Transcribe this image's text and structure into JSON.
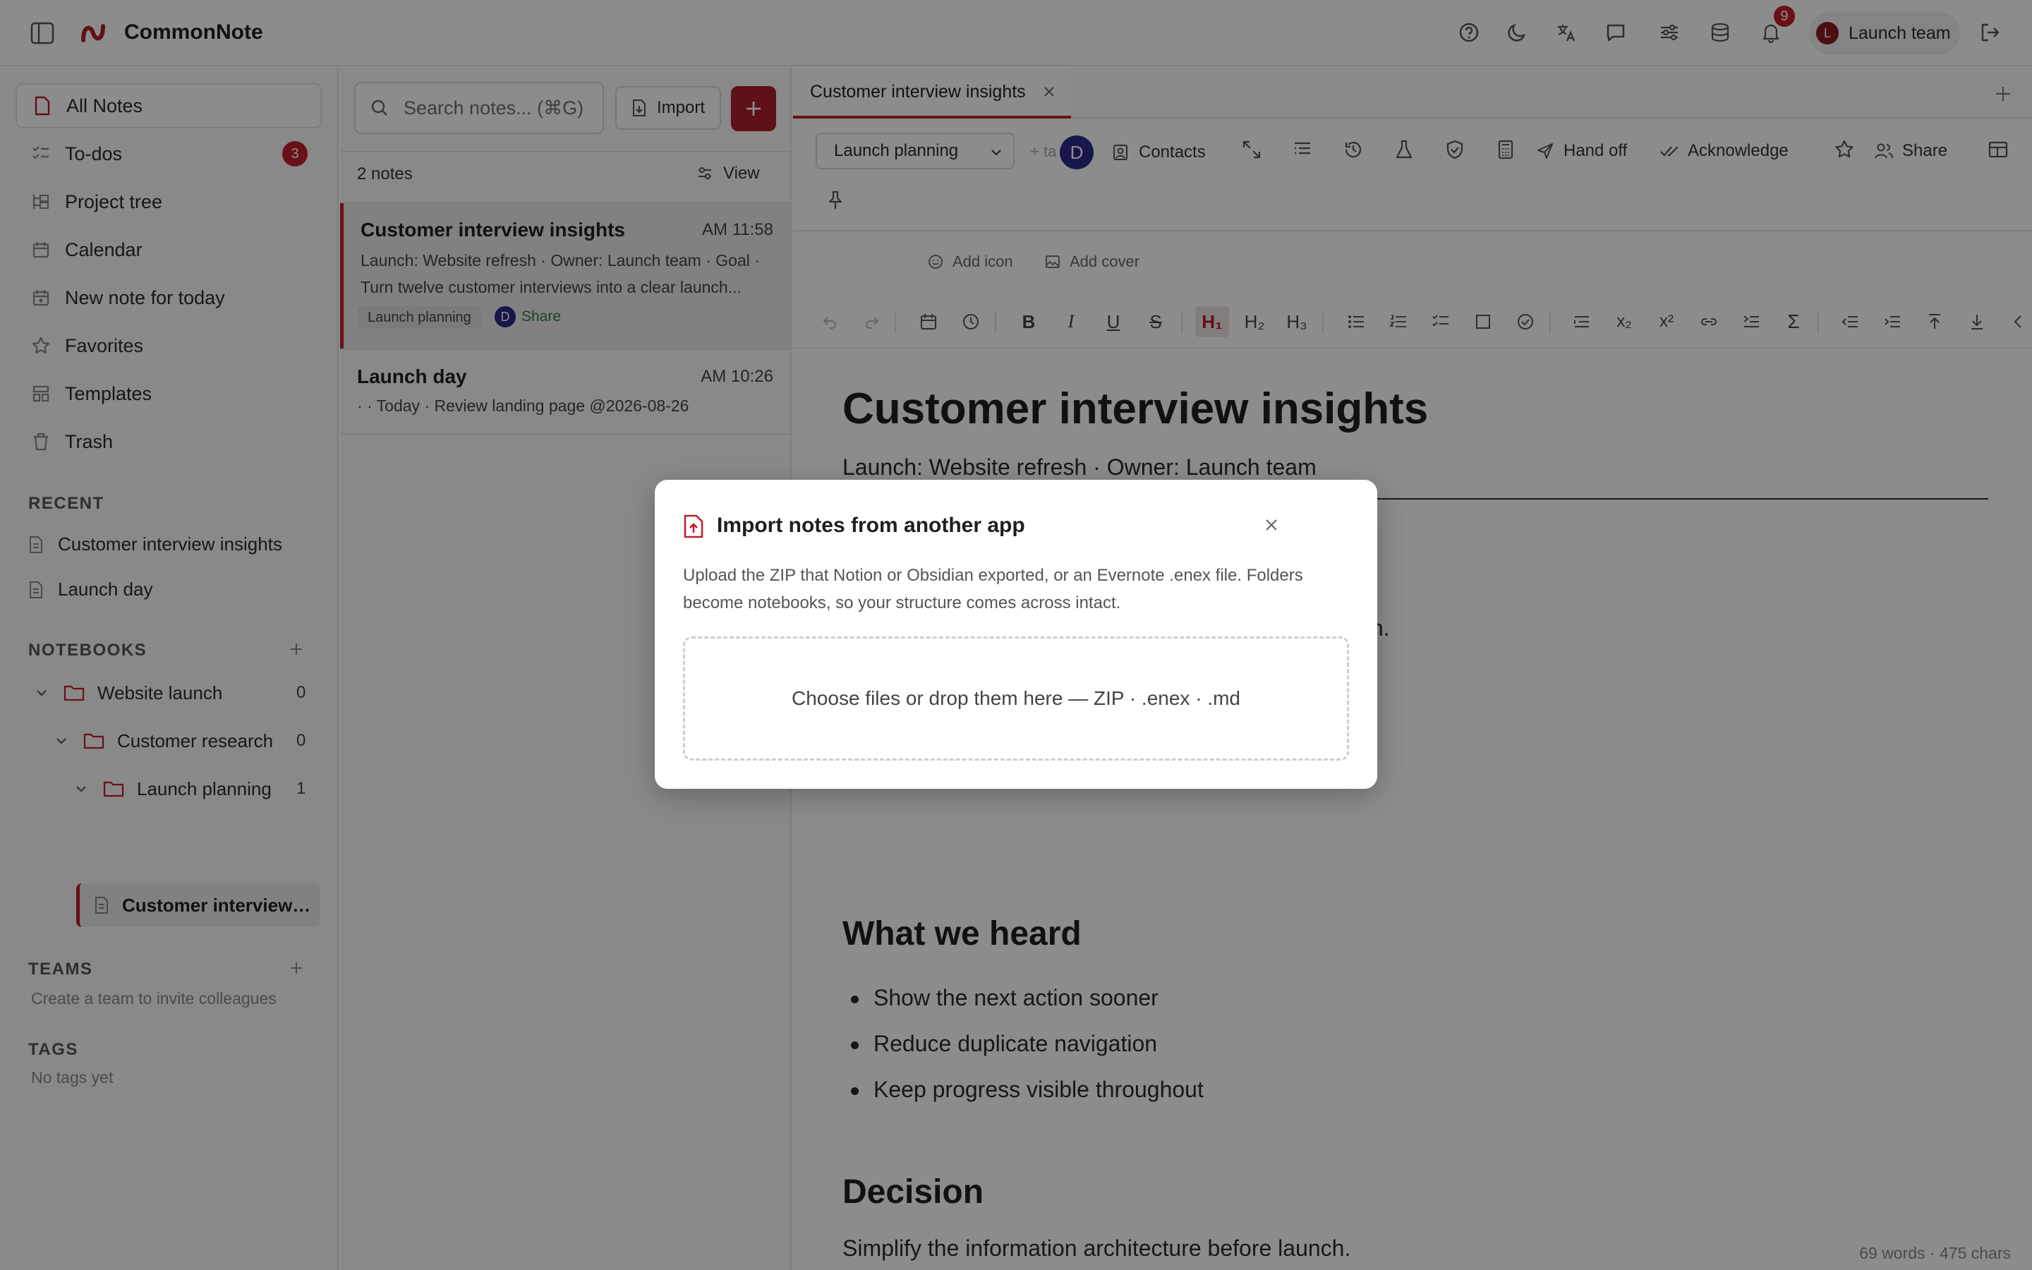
{
  "app": {
    "name": "CommonNote"
  },
  "topbar": {
    "notification_count": "9",
    "team": {
      "initial": "L",
      "label": "Launch team"
    },
    "icons": [
      "help-icon",
      "moon-icon",
      "translate-icon",
      "chat-icon",
      "sliders-icon",
      "database-icon",
      "bell-icon",
      "logout-icon"
    ]
  },
  "sidebar": {
    "nav": [
      {
        "label": "All Notes",
        "icon": "note-icon"
      },
      {
        "label": "To-dos",
        "icon": "checklist-icon",
        "badge": "3"
      },
      {
        "label": "Project tree",
        "icon": "tree-icon"
      },
      {
        "label": "Calendar",
        "icon": "calendar-icon"
      },
      {
        "label": "New note for today",
        "icon": "calendar-plus-icon"
      },
      {
        "label": "Favorites",
        "icon": "star-icon"
      },
      {
        "label": "Templates",
        "icon": "template-icon"
      },
      {
        "label": "Trash",
        "icon": "trash-icon"
      }
    ],
    "recent_title": "RECENT",
    "recent": [
      "Customer interview insights",
      "Launch day"
    ],
    "notebooks_title": "NOTEBOOKS",
    "notebooks": [
      {
        "label": "Website launch",
        "count": "0"
      },
      {
        "label": "Customer research",
        "count": "0"
      },
      {
        "label": "Launch planning",
        "count": "1"
      }
    ],
    "tree_note": "Customer interview i...",
    "teams_title": "TEAMS",
    "teams_hint": "Create a team to invite colleagues",
    "tags_title": "TAGS",
    "tags_hint": "No tags yet"
  },
  "notes_panel": {
    "search_placeholder": "Search notes... (⌘G)",
    "import_label": "Import",
    "count_label": "2 notes",
    "view_label": "View",
    "notes": [
      {
        "title": "Customer interview insights",
        "time": "AM 11:58",
        "snippet": "Launch: Website refresh · Owner: Launch team · Goal · Turn twelve customer interviews into a clear launch...",
        "tag": "Launch planning",
        "share_initial": "D",
        "share_label": "Share"
      },
      {
        "title": "Launch day",
        "time": "AM 10:26",
        "snippet": "· · Today · Review landing page @2026-08-26"
      }
    ]
  },
  "editor": {
    "tab_title": "Customer interview insights",
    "notebook_select": "Launch planning",
    "tag_placeholder": "+ ta",
    "collaborator_initial": "D",
    "toolbar": {
      "contacts": "Contacts",
      "hand_off": "Hand off",
      "acknowledge": "Acknowledge",
      "share": "Share"
    },
    "add_icon": "Add icon",
    "add_cover": "Add cover",
    "format": {
      "h1": "H₁",
      "h2": "H₂",
      "h3": "H₃",
      "bold": "B",
      "italic": "I",
      "underline": "U",
      "strike": "S",
      "sub": "x₂",
      "sup": "x²",
      "sigma": "Σ"
    },
    "doc": {
      "title": "Customer interview insights",
      "subtitle": "Launch: Website refresh · Owner: Launch team",
      "fragment": "lan.",
      "heard_heading": "What we heard",
      "heard_items": [
        "Show the next action sooner",
        "Reduce duplicate navigation",
        "Keep progress visible throughout"
      ],
      "decision_heading": "Decision",
      "decision_text": "Simplify the information architecture before launch."
    },
    "status": "69 words · 475 chars"
  },
  "modal": {
    "title": "Import notes from another app",
    "description": "Upload the ZIP that Notion or Obsidian exported, or an Evernote .enex file. Folders become notebooks, so your structure comes across intact.",
    "dropzone": "Choose files or drop them here — ZIP · .enex · .md"
  },
  "colors": {
    "accent": "#b01e2c",
    "badge": "#c0202a",
    "collab": "#2a2a8a"
  }
}
